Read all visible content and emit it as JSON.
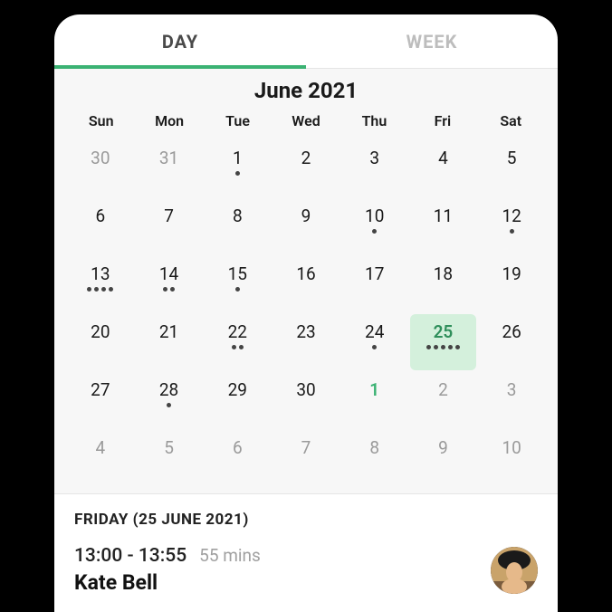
{
  "tabs": {
    "day": "DAY",
    "week": "WEEK"
  },
  "calendar": {
    "month_label": "June 2021",
    "weekdays": [
      "Sun",
      "Mon",
      "Tue",
      "Wed",
      "Thu",
      "Fri",
      "Sat"
    ],
    "rows": [
      [
        {
          "n": "30",
          "muted": true,
          "dots": 0
        },
        {
          "n": "31",
          "muted": true,
          "dots": 0
        },
        {
          "n": "1",
          "dots": 1
        },
        {
          "n": "2",
          "dots": 0
        },
        {
          "n": "3",
          "dots": 0
        },
        {
          "n": "4",
          "dots": 0
        },
        {
          "n": "5",
          "dots": 0
        }
      ],
      [
        {
          "n": "6",
          "dots": 0
        },
        {
          "n": "7",
          "dots": 0
        },
        {
          "n": "8",
          "dots": 0
        },
        {
          "n": "9",
          "dots": 0
        },
        {
          "n": "10",
          "dots": 1
        },
        {
          "n": "11",
          "dots": 0
        },
        {
          "n": "12",
          "dots": 1
        }
      ],
      [
        {
          "n": "13",
          "dots": 4
        },
        {
          "n": "14",
          "dots": 2
        },
        {
          "n": "15",
          "dots": 1
        },
        {
          "n": "16",
          "dots": 0
        },
        {
          "n": "17",
          "dots": 0
        },
        {
          "n": "18",
          "dots": 0
        },
        {
          "n": "19",
          "dots": 0
        }
      ],
      [
        {
          "n": "20",
          "dots": 0
        },
        {
          "n": "21",
          "dots": 0
        },
        {
          "n": "22",
          "dots": 2
        },
        {
          "n": "23",
          "dots": 0
        },
        {
          "n": "24",
          "dots": 1
        },
        {
          "n": "25",
          "dots": 5,
          "selected": true
        },
        {
          "n": "26",
          "dots": 0
        }
      ],
      [
        {
          "n": "27",
          "dots": 0
        },
        {
          "n": "28",
          "dots": 1
        },
        {
          "n": "29",
          "dots": 0
        },
        {
          "n": "30",
          "dots": 0
        },
        {
          "n": "1",
          "next_first": true,
          "dots": 0
        },
        {
          "n": "2",
          "muted": true,
          "dots": 0
        },
        {
          "n": "3",
          "muted": true,
          "dots": 0
        }
      ],
      [
        {
          "n": "4",
          "muted": true,
          "dots": 0
        },
        {
          "n": "5",
          "muted": true,
          "dots": 0
        },
        {
          "n": "6",
          "muted": true,
          "dots": 0
        },
        {
          "n": "7",
          "muted": true,
          "dots": 0
        },
        {
          "n": "8",
          "muted": true,
          "dots": 0
        },
        {
          "n": "9",
          "muted": true,
          "dots": 0
        },
        {
          "n": "10",
          "muted": true,
          "dots": 0
        }
      ]
    ]
  },
  "event": {
    "date_header": "FRIDAY (25 JUNE 2021)",
    "time": "13:00 - 13:55",
    "duration": "55 mins",
    "person": "Kate Bell"
  }
}
